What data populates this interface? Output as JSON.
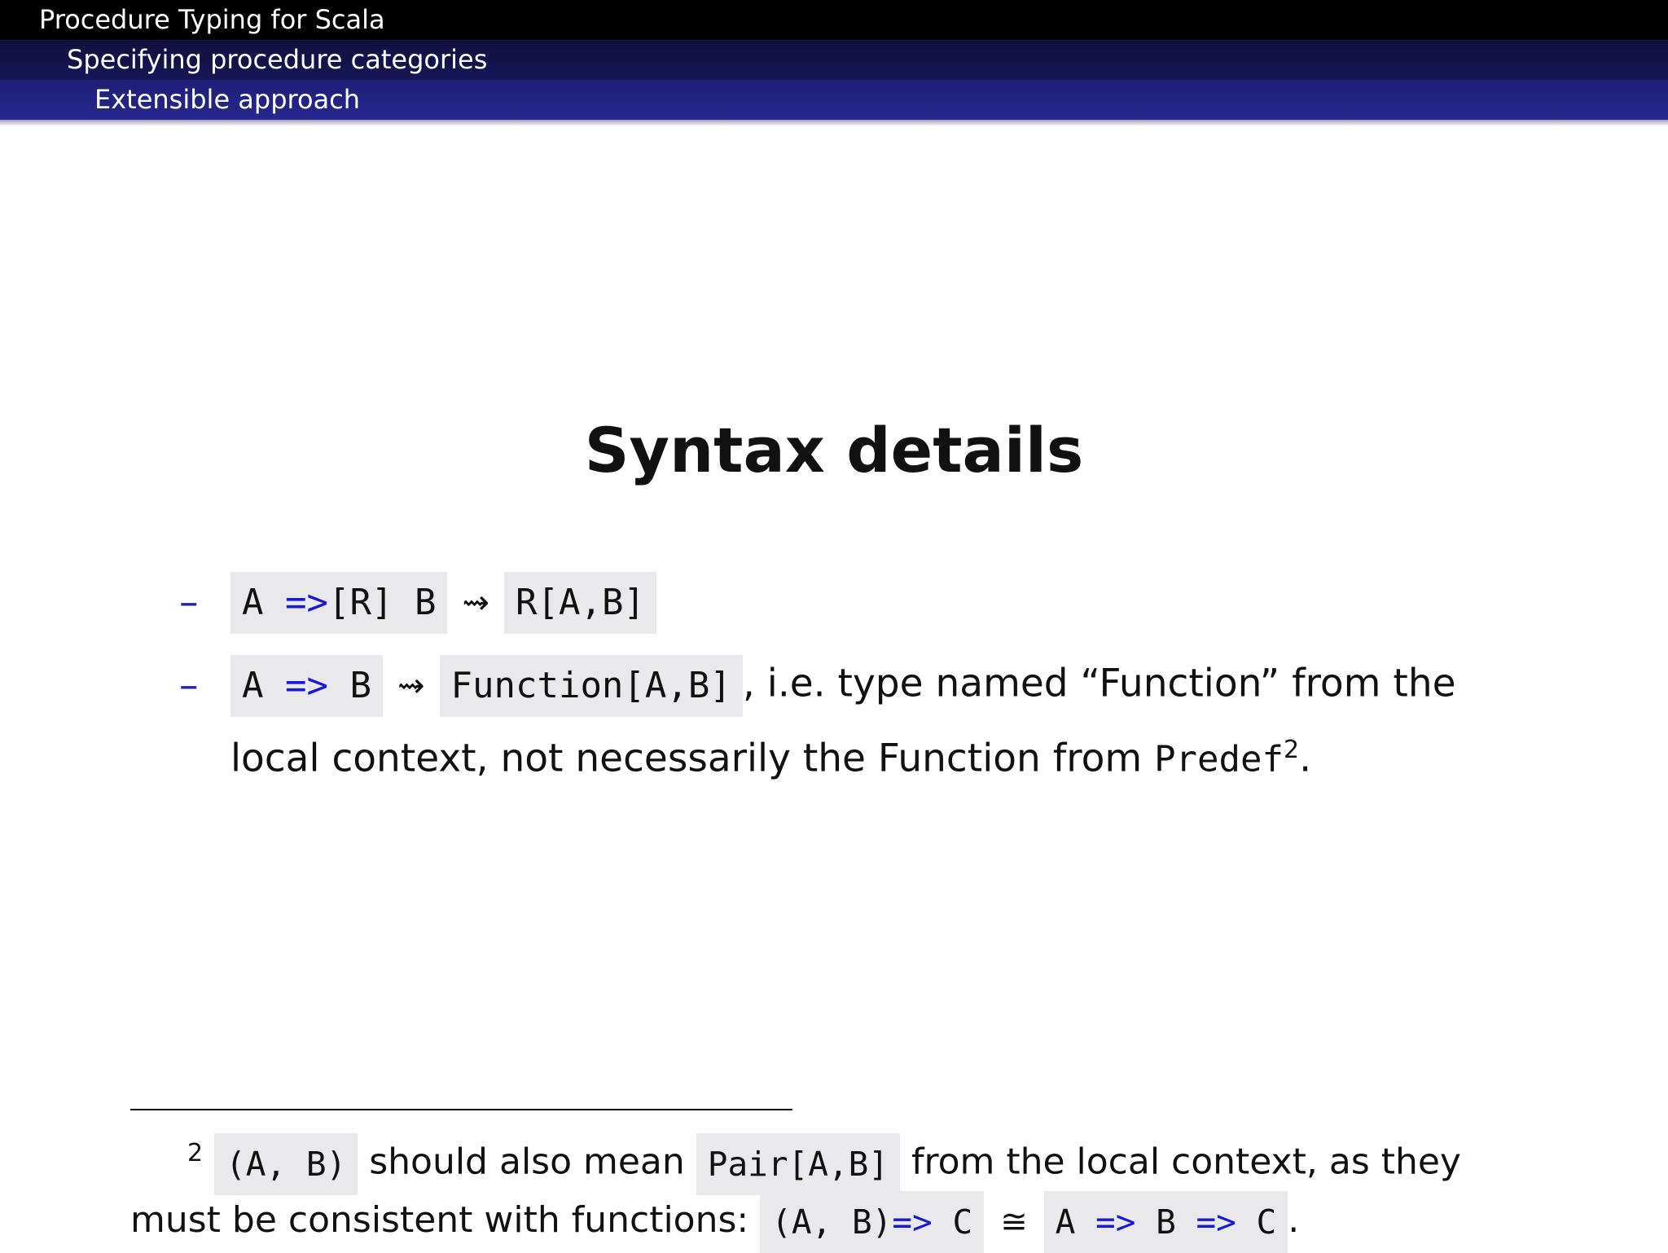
{
  "header": {
    "section": "Procedure Typing for Scala",
    "subsection": "Specifying procedure categories",
    "subsubsection": "Extensible approach"
  },
  "slide": {
    "title": "Syntax details",
    "bullet_marker": "–",
    "bullets": [
      {
        "code_a": "A",
        "code_arrow": "=>",
        "code_r": "[R]",
        "code_b": "B",
        "leadsto": "⇝",
        "result": "R[A,B]"
      },
      {
        "code_a": "A",
        "code_arrow": "=>",
        "code_b": "B",
        "leadsto": "⇝",
        "result": "Function[A,B]",
        "text_1": ", i.e. type named “Function” from the",
        "text_2": "local context, not necessarily the Function from ",
        "predef": "Predef",
        "footnote_mark": "2",
        "end": "."
      }
    ]
  },
  "footnote": {
    "mark": "2",
    "code_pair_a": "(A,",
    "code_pair_b": "B)",
    "text_1": "should also mean",
    "code_pair_type": "Pair[A,B]",
    "text_2": "from the local context, as they",
    "text_3": "must be consistent with functions:",
    "code_left_a": "(A,",
    "code_left_b": "B)",
    "code_arrow": "=>",
    "code_c": "C",
    "iso": "≅",
    "code_right_a": "A",
    "code_right_b": "B",
    "code_right_c": "C",
    "end": "."
  }
}
